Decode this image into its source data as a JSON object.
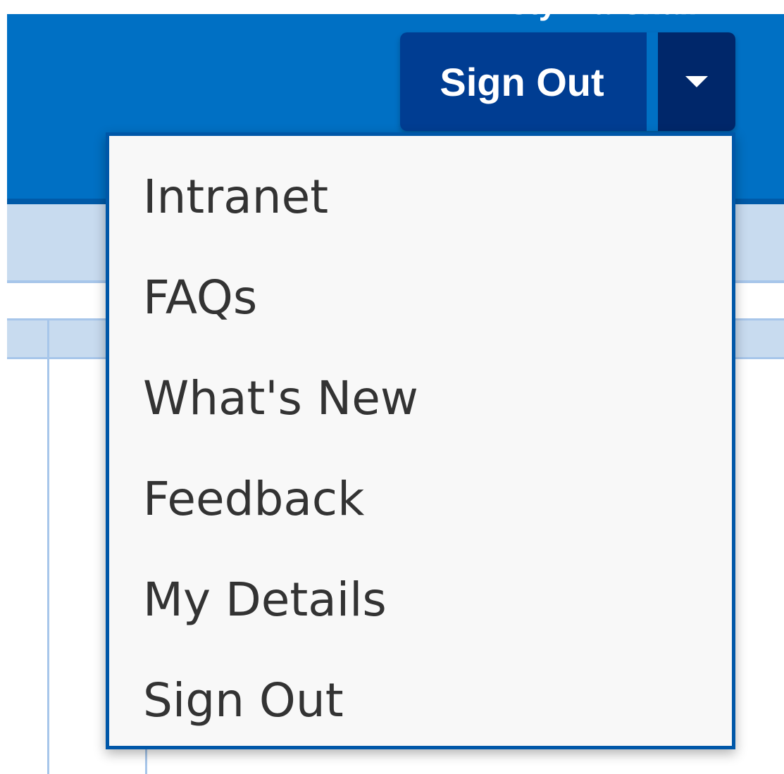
{
  "header": {
    "user_name": "Kirsty Marshall"
  },
  "account_menu": {
    "button_label": "Sign Out",
    "items": [
      {
        "label": "Intranet"
      },
      {
        "label": "FAQs"
      },
      {
        "label": "What's New"
      },
      {
        "label": "Feedback"
      },
      {
        "label": "My Details"
      },
      {
        "label": "Sign Out"
      }
    ]
  },
  "colors": {
    "header_blue": "#0070c4",
    "button_navy": "#003d92",
    "caret_navy": "#00276a",
    "dropdown_border": "#0057a8",
    "subnav_light": "#c8dbef"
  },
  "icons": {
    "caret": "caret-down-icon"
  }
}
